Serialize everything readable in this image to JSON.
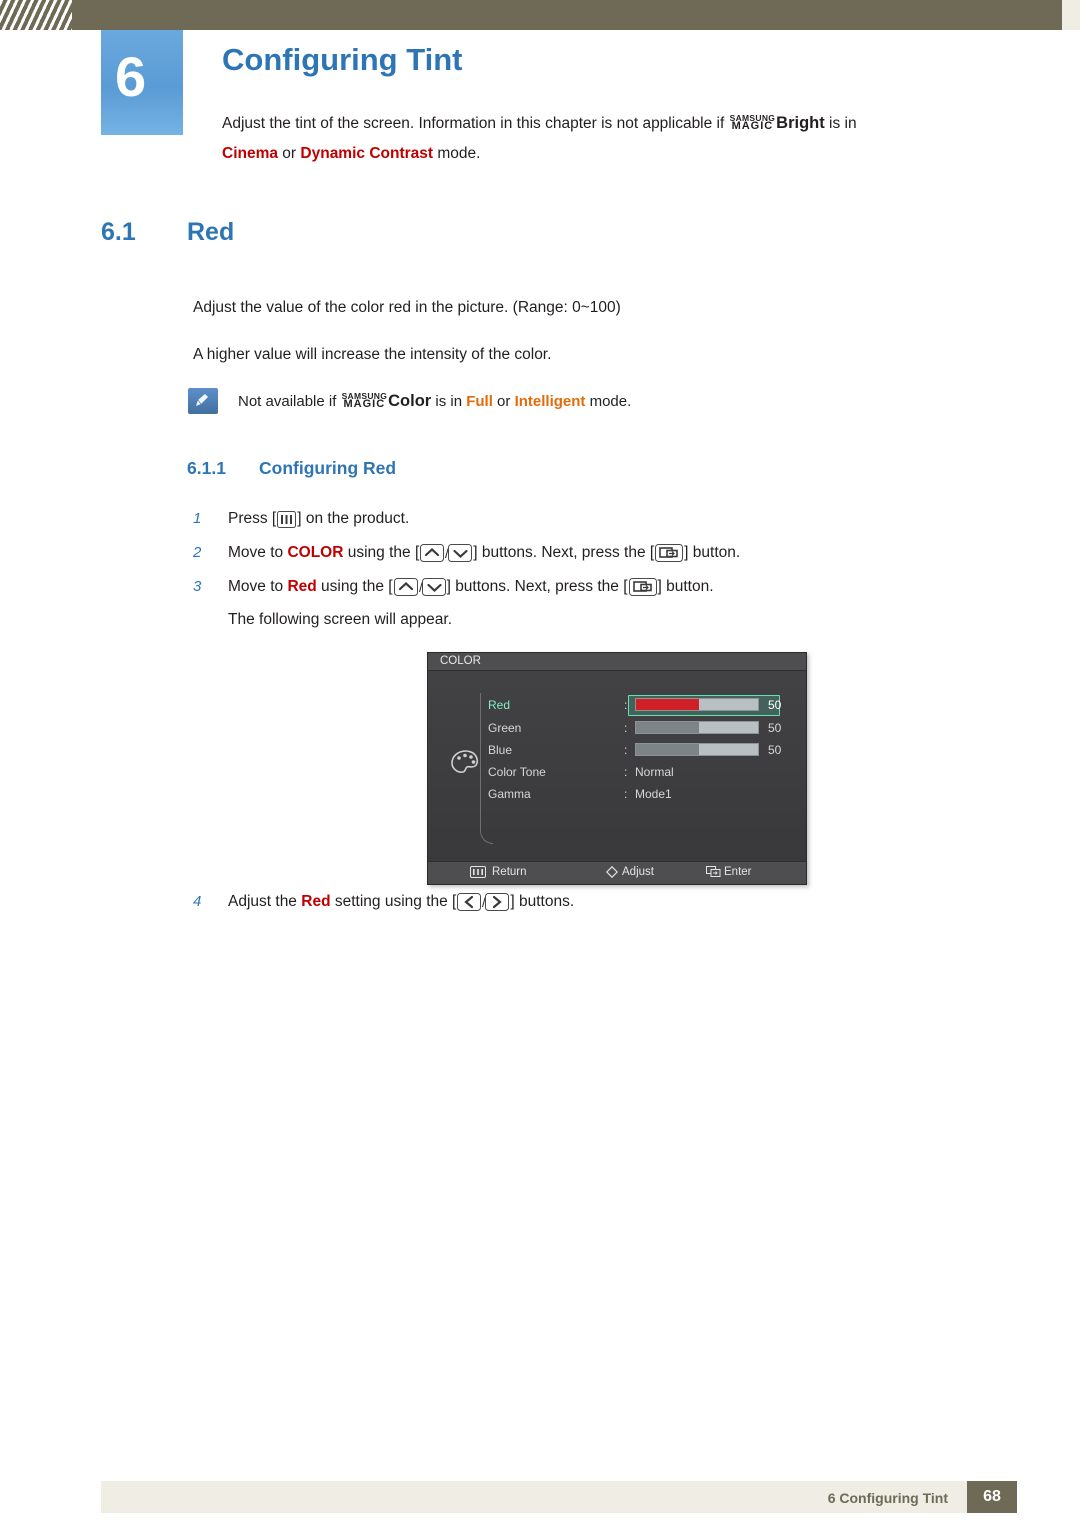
{
  "header": {
    "chapter_number": "6",
    "title": "Configuring Tint"
  },
  "intro": {
    "part1": "Adjust the tint of the screen. Information in this chapter is not applicable if ",
    "magic_top": "SAMSUNG",
    "magic_bottom": "MAGIC",
    "bright": "Bright",
    "part2": " is in",
    "kw_cinema": "Cinema",
    "or1": " or ",
    "kw_dynamic": "Dynamic Contrast",
    "part3": " mode."
  },
  "section": {
    "number": "6.1",
    "title": "Red",
    "para1": "Adjust the value of the color red in the picture. (Range: 0~100)",
    "para2": "A higher value will increase the intensity of the color."
  },
  "note": {
    "prefix": "Not available if ",
    "magic_top": "SAMSUNG",
    "magic_bottom": "MAGIC",
    "color_word": "Color",
    "mid": " is in ",
    "kw_full": "Full",
    "or": " or ",
    "kw_intelligent": "Intelligent",
    "suffix": " mode."
  },
  "subsection": {
    "number": "6.1.1",
    "title": "Configuring Red"
  },
  "steps": [
    {
      "index": "1",
      "pre": "Press [",
      "post": "] on the product."
    },
    {
      "index": "2",
      "pre": "Move to ",
      "keyword": "COLOR",
      "mid": " using the [",
      "mid2": "] buttons. Next, press the [",
      "post": "] button."
    },
    {
      "index": "3",
      "pre": "Move to ",
      "keyword": "Red",
      "mid": " using the [",
      "mid2": "] buttons. Next, press the [",
      "post": "] button.",
      "extra_line": "The following screen will appear."
    },
    {
      "index": "4",
      "pre": "Adjust the ",
      "keyword": "Red",
      "mid": " setting using the [",
      "post": "] buttons."
    }
  ],
  "osd": {
    "title": "COLOR",
    "rows": [
      {
        "label": "Red",
        "colon": ":",
        "value": "50",
        "bar": 52,
        "selected": true
      },
      {
        "label": "Green",
        "colon": ":",
        "value": "50",
        "bar": 52,
        "selected": false
      },
      {
        "label": "Blue",
        "colon": ":",
        "value": "50",
        "bar": 52,
        "selected": false
      },
      {
        "label": "Color Tone",
        "colon": ":",
        "value": "Normal",
        "selected": false
      },
      {
        "label": "Gamma",
        "colon": ":",
        "value": "Mode1",
        "selected": false
      }
    ],
    "footer": {
      "return": "Return",
      "adjust": "Adjust",
      "enter": "Enter"
    }
  },
  "footer": {
    "text": "6 Configuring Tint",
    "page": "68"
  },
  "colors": {
    "heading_blue": "#2e75b6",
    "badge_blue": "#5b9bd5",
    "band_olive": "#6e6a56",
    "keyword_red": "#c00000",
    "keyword_orange": "#e36c0a",
    "osd_red_bar": "#cf2027",
    "osd_select_green": "#63e0b4"
  }
}
